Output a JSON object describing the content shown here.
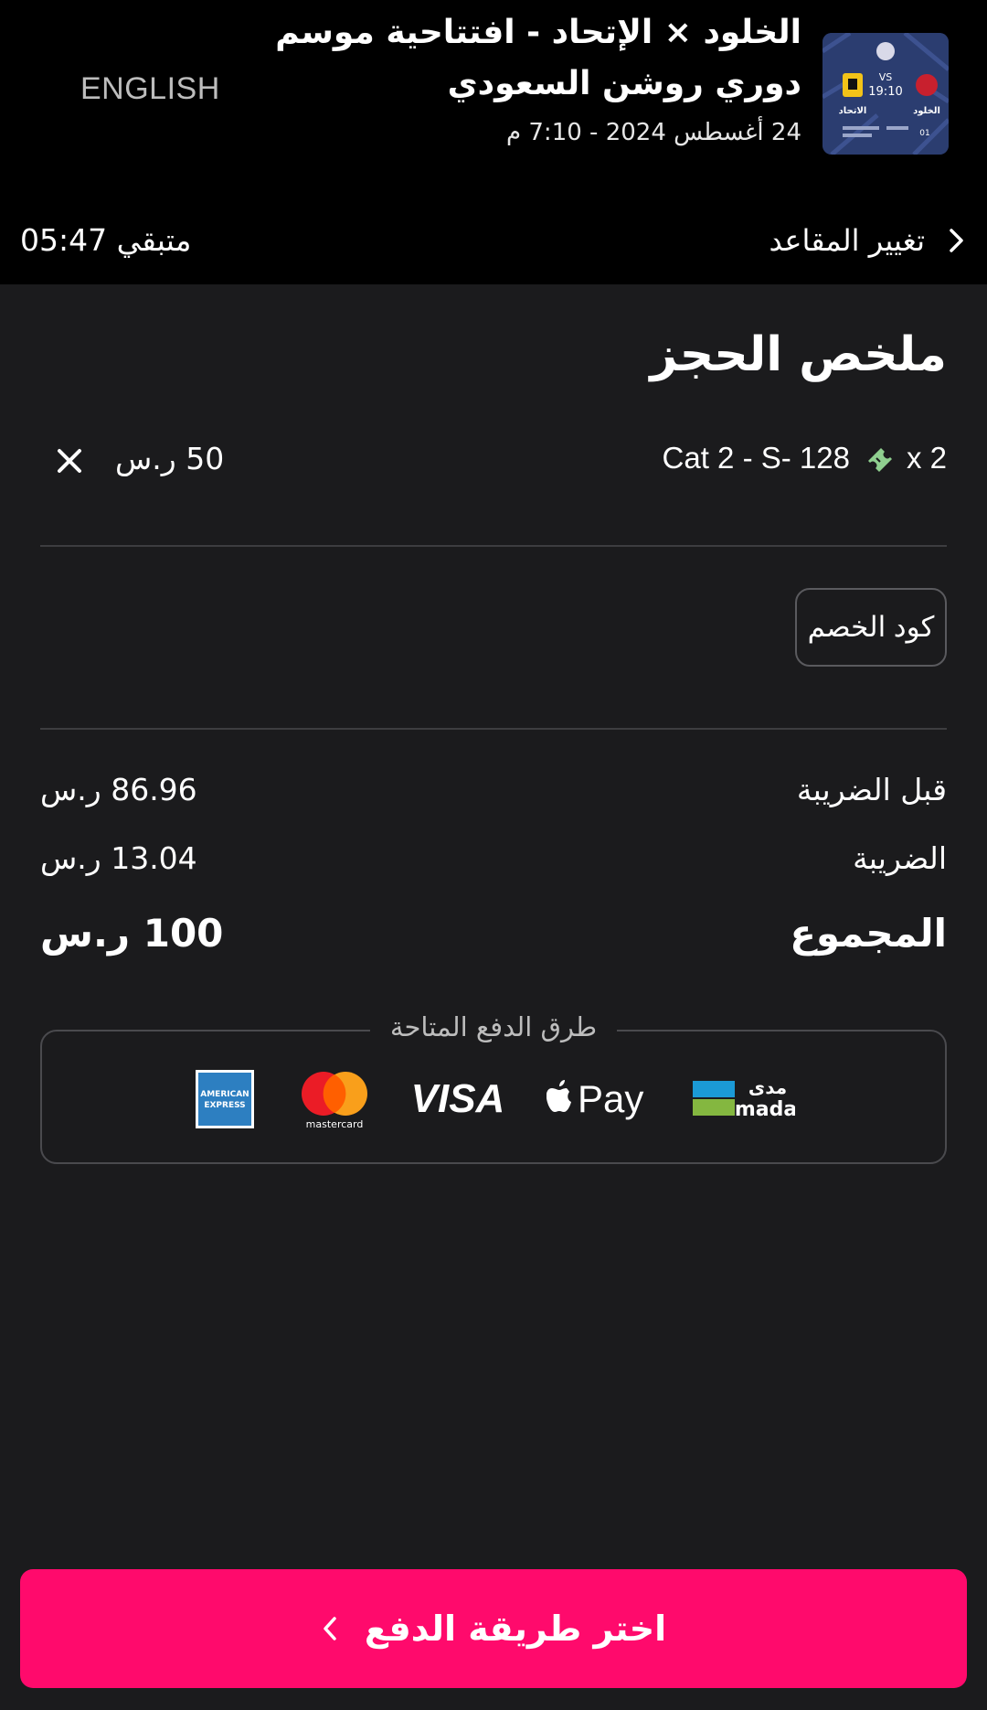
{
  "header": {
    "language_toggle": "ENGLISH",
    "event_title_line1": "الخلود × الإتحاد - افتتاحية موسم",
    "event_title_line2": "دوري روشن السعودي",
    "event_date": "24 أغسطس 2024 - 7:10 م",
    "thumb": {
      "team_left": "الاتحاد",
      "team_right": "الخلود",
      "vs": "VS",
      "time": "19:10",
      "round": "01"
    },
    "timer_label": "متبقي 05:47",
    "change_seats_label": "تغيير المقاعد"
  },
  "summary": {
    "title": "ملخص الحجز",
    "ticket": {
      "description": "Cat 2 - S- 128",
      "quantity": "x 2",
      "price": "50 ر.س"
    },
    "promo_button": "كود الخصم",
    "subtotal_label": "قبل الضريبة",
    "subtotal_value": "86.96 ر.س",
    "tax_label": "الضريبة",
    "tax_value": "13.04 ر.س",
    "total_label": "المجموع",
    "total_value": "100 ر.س"
  },
  "payment": {
    "legend": "طرق الدفع المتاحة",
    "methods": [
      "American Express",
      "mastercard",
      "VISA",
      "Pay",
      "مدى mada"
    ],
    "mastercard_text": "mastercard",
    "visa_text": "VISA",
    "applepay_text": "Pay",
    "mada_ar": "مدى",
    "mada_en": "mada",
    "amex_line1": "AMERICAN",
    "amex_line2": "EXPRESS"
  },
  "cta": {
    "label": "اختر طريقة الدفع"
  },
  "colors": {
    "background": "#1b1b1d",
    "header": "#000000",
    "accent": "#ff0a6c"
  }
}
